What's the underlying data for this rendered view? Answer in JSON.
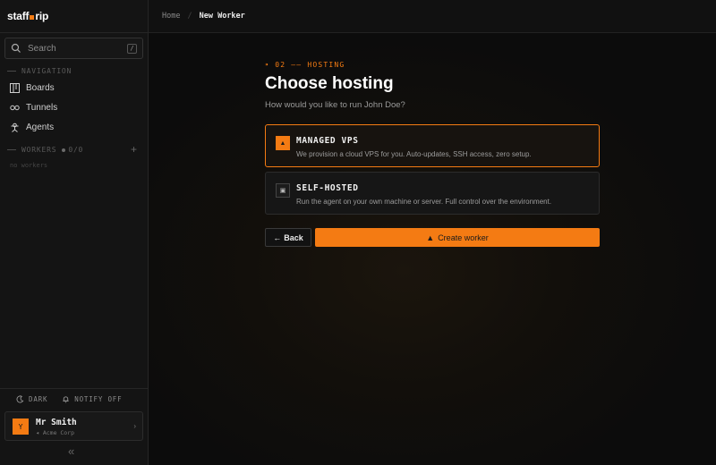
{
  "sidebar": {
    "logo_left": "staff",
    "logo_right": "rip",
    "search": {
      "placeholder": "Search",
      "shortcut": "/"
    },
    "navigation_header": "NAVIGATION",
    "nav_items": [
      {
        "label": "Boards",
        "icon": "boards-icon"
      },
      {
        "label": "Tunnels",
        "icon": "tunnels-icon"
      },
      {
        "label": "Agents",
        "icon": "agents-icon"
      }
    ],
    "workers_header": "WORKERS",
    "workers_count": "0/0",
    "workers_add": "+",
    "workers_empty": "no workers",
    "theme_toggle": "DARK",
    "notify_toggle": "NOTIFY OFF",
    "user": {
      "initial": "Y",
      "name": "Mr Smith",
      "org": "Acme Corp"
    },
    "collapse": "«"
  },
  "topbar": {
    "breadcrumb": [
      "Home",
      "New Worker"
    ],
    "separator": "/"
  },
  "main": {
    "step": "02 —— HOSTING",
    "step_marker": "⁍",
    "title": "Choose hosting",
    "subtitle": "How would you like to run John Doe?",
    "options": [
      {
        "title": "MANAGED VPS",
        "description": "We provision a cloud VPS for you. Auto-updates, SSH access, zero setup.",
        "selected": true,
        "icon": "▲"
      },
      {
        "title": "SELF-HOSTED",
        "description": "Run the agent on your own machine or server. Full control over the environment.",
        "selected": false,
        "icon": "▣"
      }
    ],
    "back_label": "Back",
    "back_arrow": "←",
    "create_label": "Create worker",
    "create_icon": "▲"
  },
  "colors": {
    "accent": "#f47b13",
    "background": "#0d0d0d",
    "sidebar": "#141414"
  }
}
